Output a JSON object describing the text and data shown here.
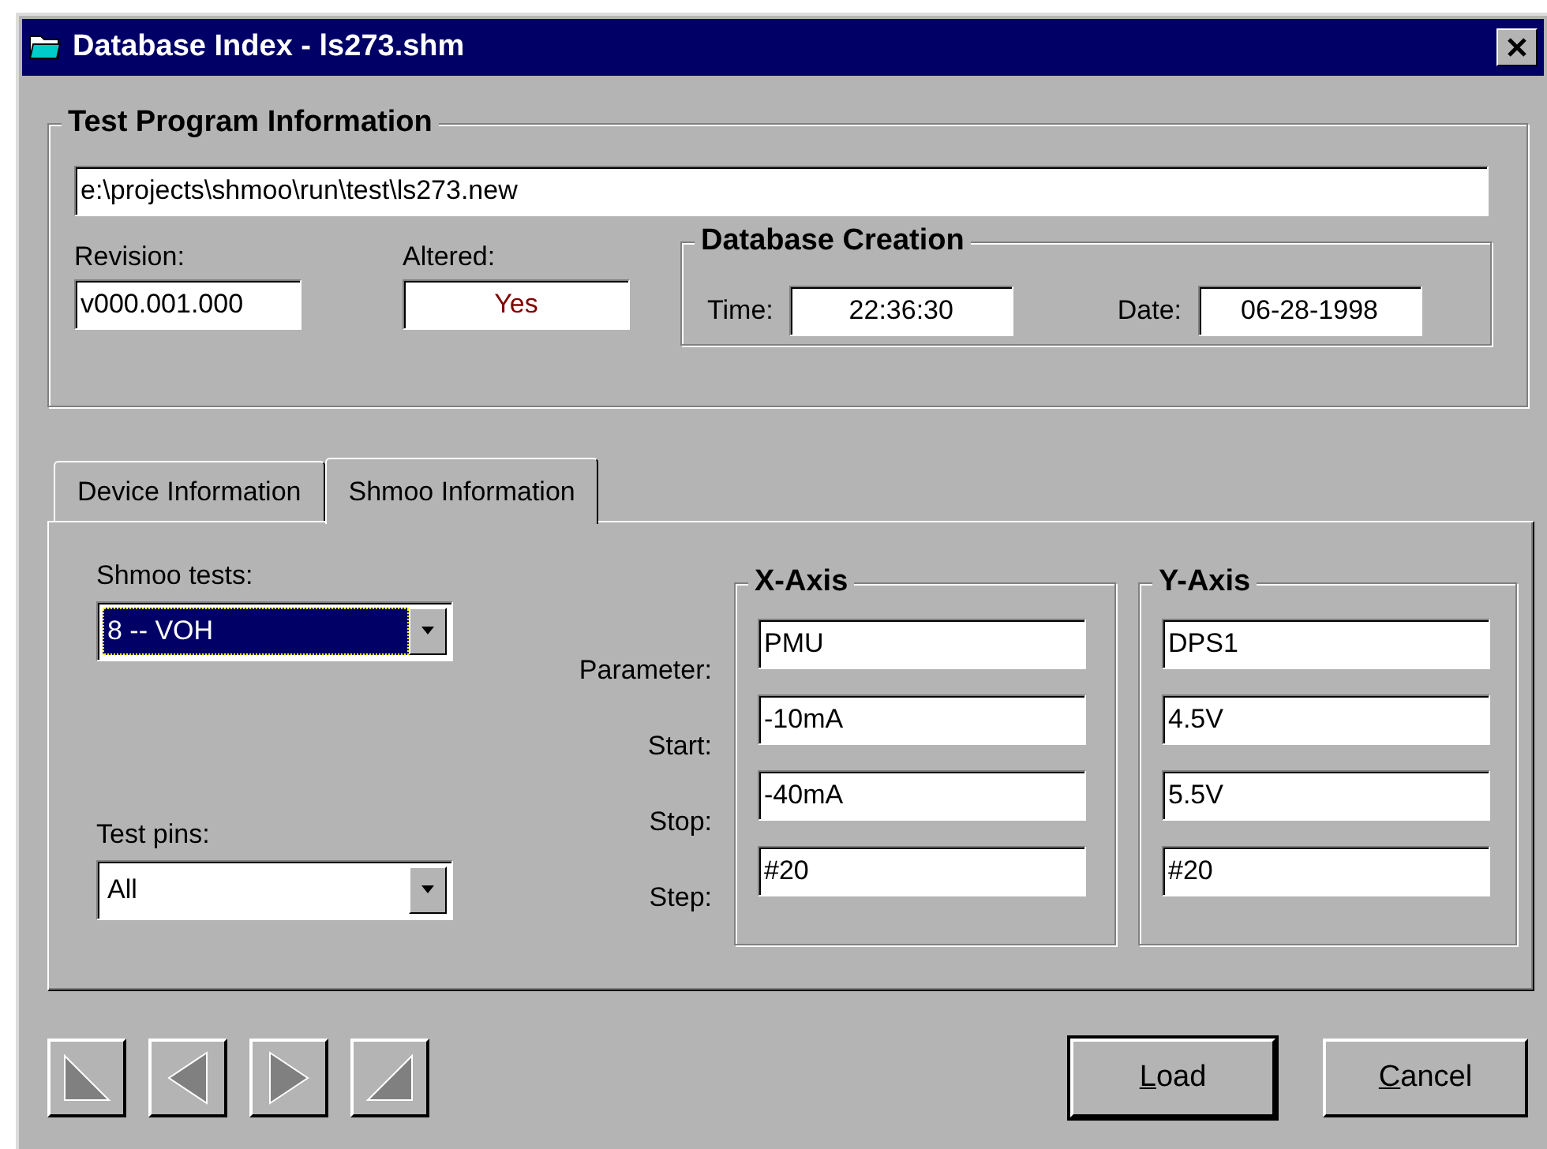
{
  "window": {
    "title": "Database Index - ls273.shm"
  },
  "test_program": {
    "title": "Test Program Information",
    "path": "e:\\projects\\shmoo\\run\\test\\ls273.new",
    "revision": {
      "label": "Revision:",
      "value": "v000.001.000"
    },
    "altered": {
      "label": "Altered:",
      "value": "Yes"
    },
    "database_creation": {
      "title": "Database Creation",
      "time": {
        "label": "Time:",
        "value": "22:36:30"
      },
      "date": {
        "label": "Date:",
        "value": "06-28-1998"
      }
    }
  },
  "tabs": [
    {
      "label": "Device Information",
      "selected": false
    },
    {
      "label": "Shmoo Information",
      "selected": true
    }
  ],
  "shmoo": {
    "shmoo_tests": {
      "label": "Shmoo tests:",
      "value": "8 -- VOH",
      "focused": true
    },
    "test_pins": {
      "label": "Test pins:",
      "value": "All",
      "focused": false
    },
    "row_labels": [
      "Parameter:",
      "Start:",
      "Stop:",
      "Step:"
    ],
    "axes": [
      {
        "title": "X-Axis",
        "values": [
          "PMU",
          "-10mA",
          "-40mA",
          "#20"
        ]
      },
      {
        "title": "Y-Axis",
        "values": [
          "DPS1",
          "4.5V",
          "5.5V",
          "#20"
        ]
      }
    ]
  },
  "nav_buttons": [
    {
      "kind": "first",
      "disabled": true
    },
    {
      "kind": "previous",
      "disabled": true
    },
    {
      "kind": "next",
      "disabled": true
    },
    {
      "kind": "last",
      "disabled": true
    }
  ],
  "buttons": [
    {
      "accel": "L",
      "rest": "oad",
      "default": true
    },
    {
      "accel": "C",
      "rest": "ancel",
      "default": false
    }
  ]
}
